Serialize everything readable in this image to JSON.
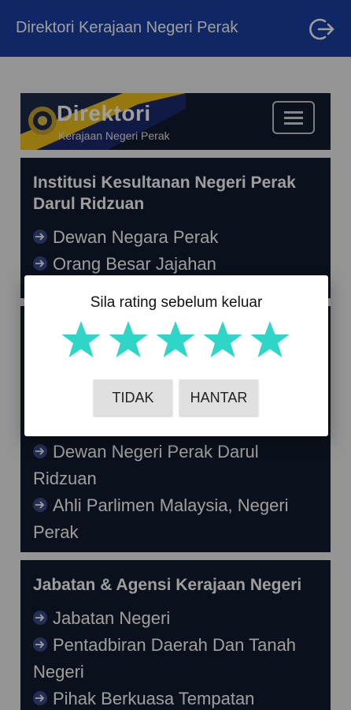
{
  "appbar": {
    "title": "Direktori Kerajaan Negeri Perak",
    "logout_icon": "logout-icon",
    "color": "#1a3fa3"
  },
  "header": {
    "title": "Direktori",
    "subtitle": "Kerajaan Negeri Perak",
    "menu_icon": "hamburger-menu-icon"
  },
  "cards": [
    {
      "title": "Institusi Kesultanan Negeri Perak Darul Ridzuan",
      "items": [
        "Dewan Negara Perak",
        "Orang Besar Jajahan"
      ]
    },
    {
      "title": "",
      "items": [
        "Dewan Negeri Perak Darul Ridzuan",
        "Ahli Parlimen Malaysia, Negeri Perak"
      ]
    },
    {
      "title": "Jabatan & Agensi Kerajaan Negeri",
      "items": [
        "Jabatan Negeri",
        "Pentadbiran Daerah Dan Tanah Negeri",
        "Pihak Berkuasa Tempatan"
      ]
    }
  ],
  "dialog": {
    "title": "Sila rating sebelum keluar",
    "rating": 5,
    "rating_max": 5,
    "star_color": "#2fd6c8",
    "cancel_label": "TIDAK",
    "submit_label": "HANTAR"
  }
}
